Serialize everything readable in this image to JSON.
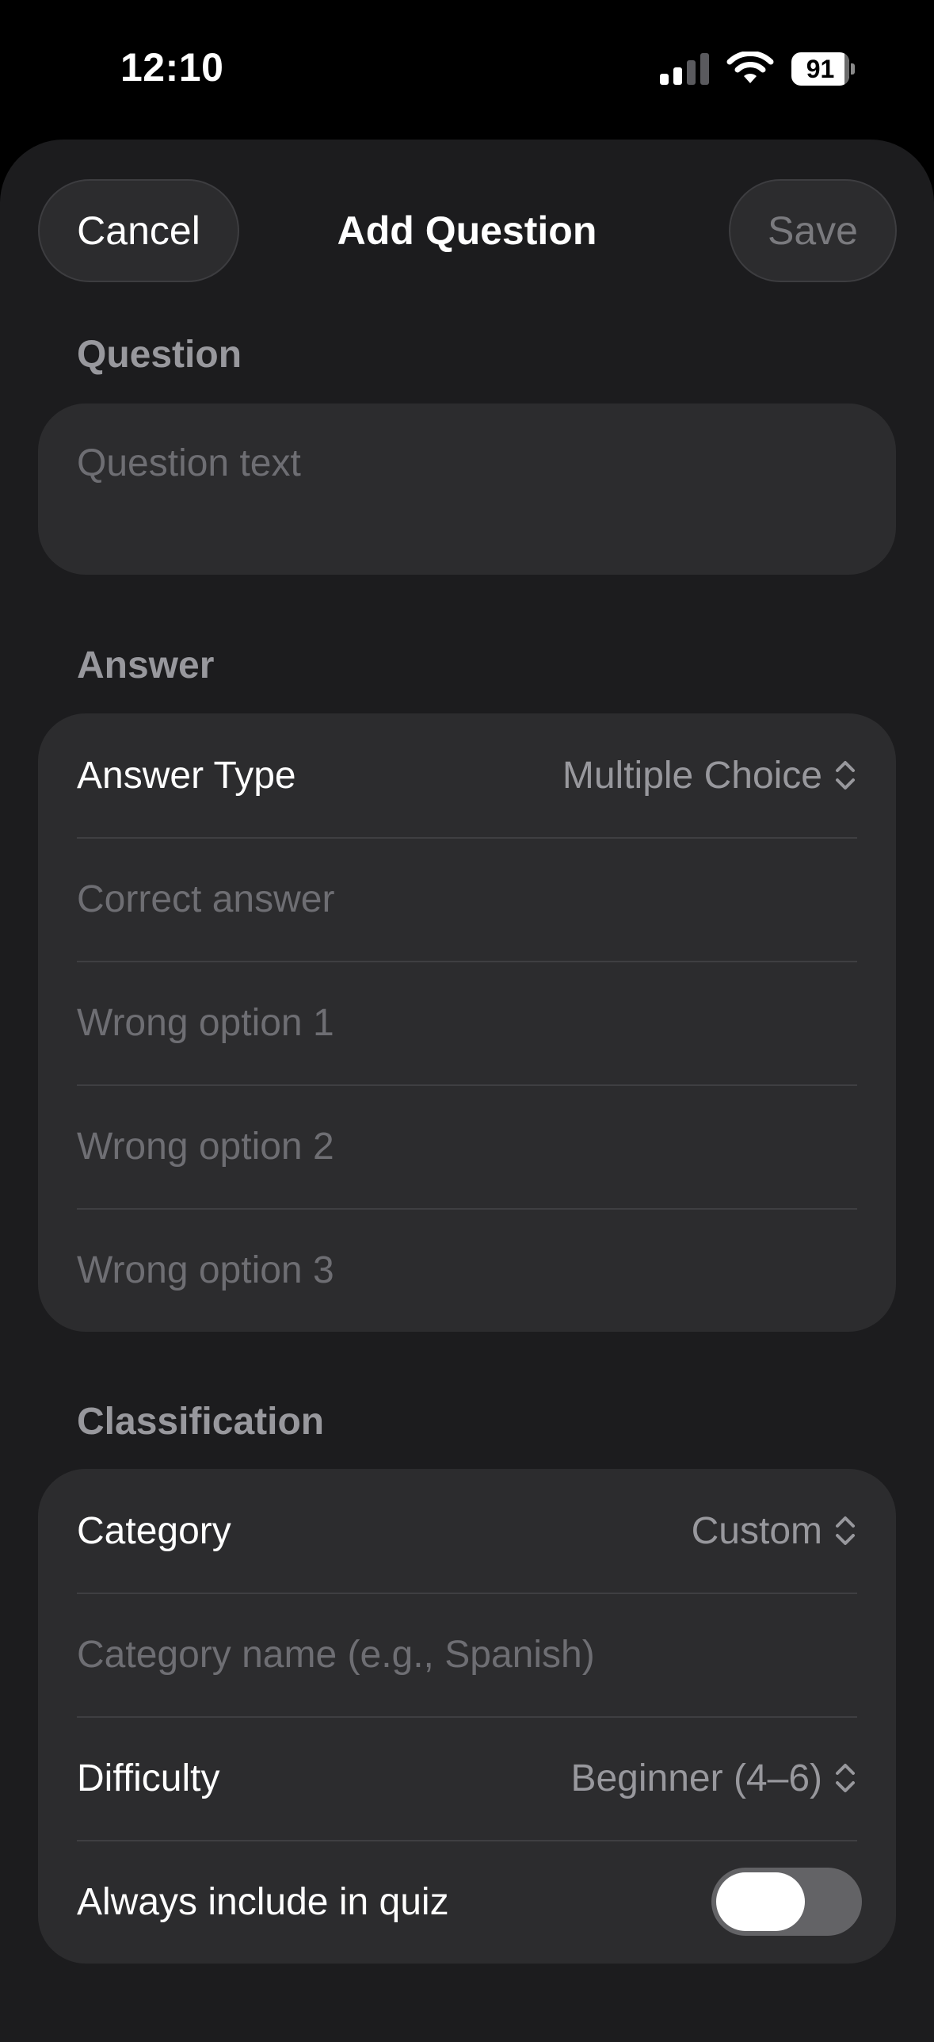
{
  "status_bar": {
    "time": "12:10",
    "battery_level": "91",
    "signal_icon": "cellular-signal-icon",
    "wifi_icon": "wifi-icon"
  },
  "nav": {
    "cancel_label": "Cancel",
    "title": "Add Question",
    "save_label": "Save"
  },
  "question_section": {
    "header": "Question",
    "placeholder": "Question text"
  },
  "answer_section": {
    "header": "Answer",
    "answer_type_label": "Answer Type",
    "answer_type_value": "Multiple Choice",
    "correct_placeholder": "Correct answer",
    "wrong_options": [
      "Wrong option 1",
      "Wrong option 2",
      "Wrong option 3"
    ]
  },
  "classification_section": {
    "header": "Classification",
    "category_label": "Category",
    "category_value": "Custom",
    "category_name_placeholder": "Category name (e.g., Spanish)",
    "difficulty_label": "Difficulty",
    "difficulty_value": "Beginner (4–6)",
    "always_include_label": "Always include in quiz",
    "always_include_on": false
  },
  "colors": {
    "background": "#000000",
    "sheet": "#1c1c1e",
    "card": "#2c2c2e",
    "placeholder": "#6e6e73",
    "secondary_text": "#98989d"
  }
}
